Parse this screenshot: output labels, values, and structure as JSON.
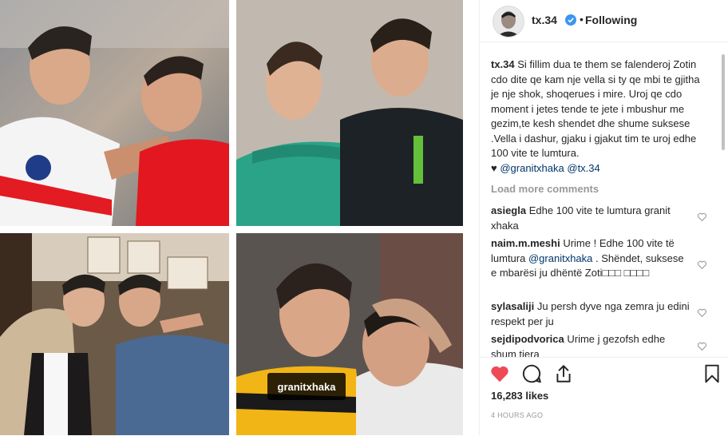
{
  "post": {
    "image_tag": "granitxhaka"
  },
  "header": {
    "username": "tx.34",
    "separator": "•",
    "follow_status": "Following"
  },
  "caption": {
    "author": "tx.34",
    "text": "Si fillim dua te them se falenderoj Zotin cdo dite qe kam nje vella si ty qe mbi te gjitha je nje shok, shoqerues i mire. Uroj qe cdo moment i jetes tende te jete i mbushur me gezim,te kesh shendet dhe shume suksese .Vella i dashur, gjaku i gjakut tim te uroj edhe 100 vite te lumtura.",
    "heart": "♥",
    "mention1": "@granitxhaka",
    "mention2": "@tx.34"
  },
  "load_more_label": "Load more comments",
  "comments": [
    {
      "user": "asiegla",
      "text": "Edhe 100 vite te lumtura granit xhaka"
    },
    {
      "user": "naim.m.meshi",
      "text_before": "Urime ! Edhe 100 vite të lumtura",
      "mention": "@granitxhaka",
      "text_after": ". Shëndet, suksese e mbarësi ju dhëntë Zoti□□□ □□□□"
    },
    {
      "user": "sylasaliji",
      "text": "Ju persh dyve nga zemra ju edini respekt per ju"
    },
    {
      "user": "sejdipodvorica",
      "text": "Urime j gezofsh edhe shum tjera"
    }
  ],
  "likes": "16,283 likes",
  "timestamp": "4 HOURS AGO",
  "icons": {
    "like": "heart-filled-icon",
    "comment": "comment-icon",
    "share": "share-icon",
    "save": "bookmark-icon",
    "comment_like": "heart-outline-icon",
    "verified": "verified-badge-icon"
  },
  "colors": {
    "like_red": "#ed4956",
    "verified_blue": "#3897f0",
    "link_blue": "#003569",
    "meta_gray": "#999999"
  }
}
